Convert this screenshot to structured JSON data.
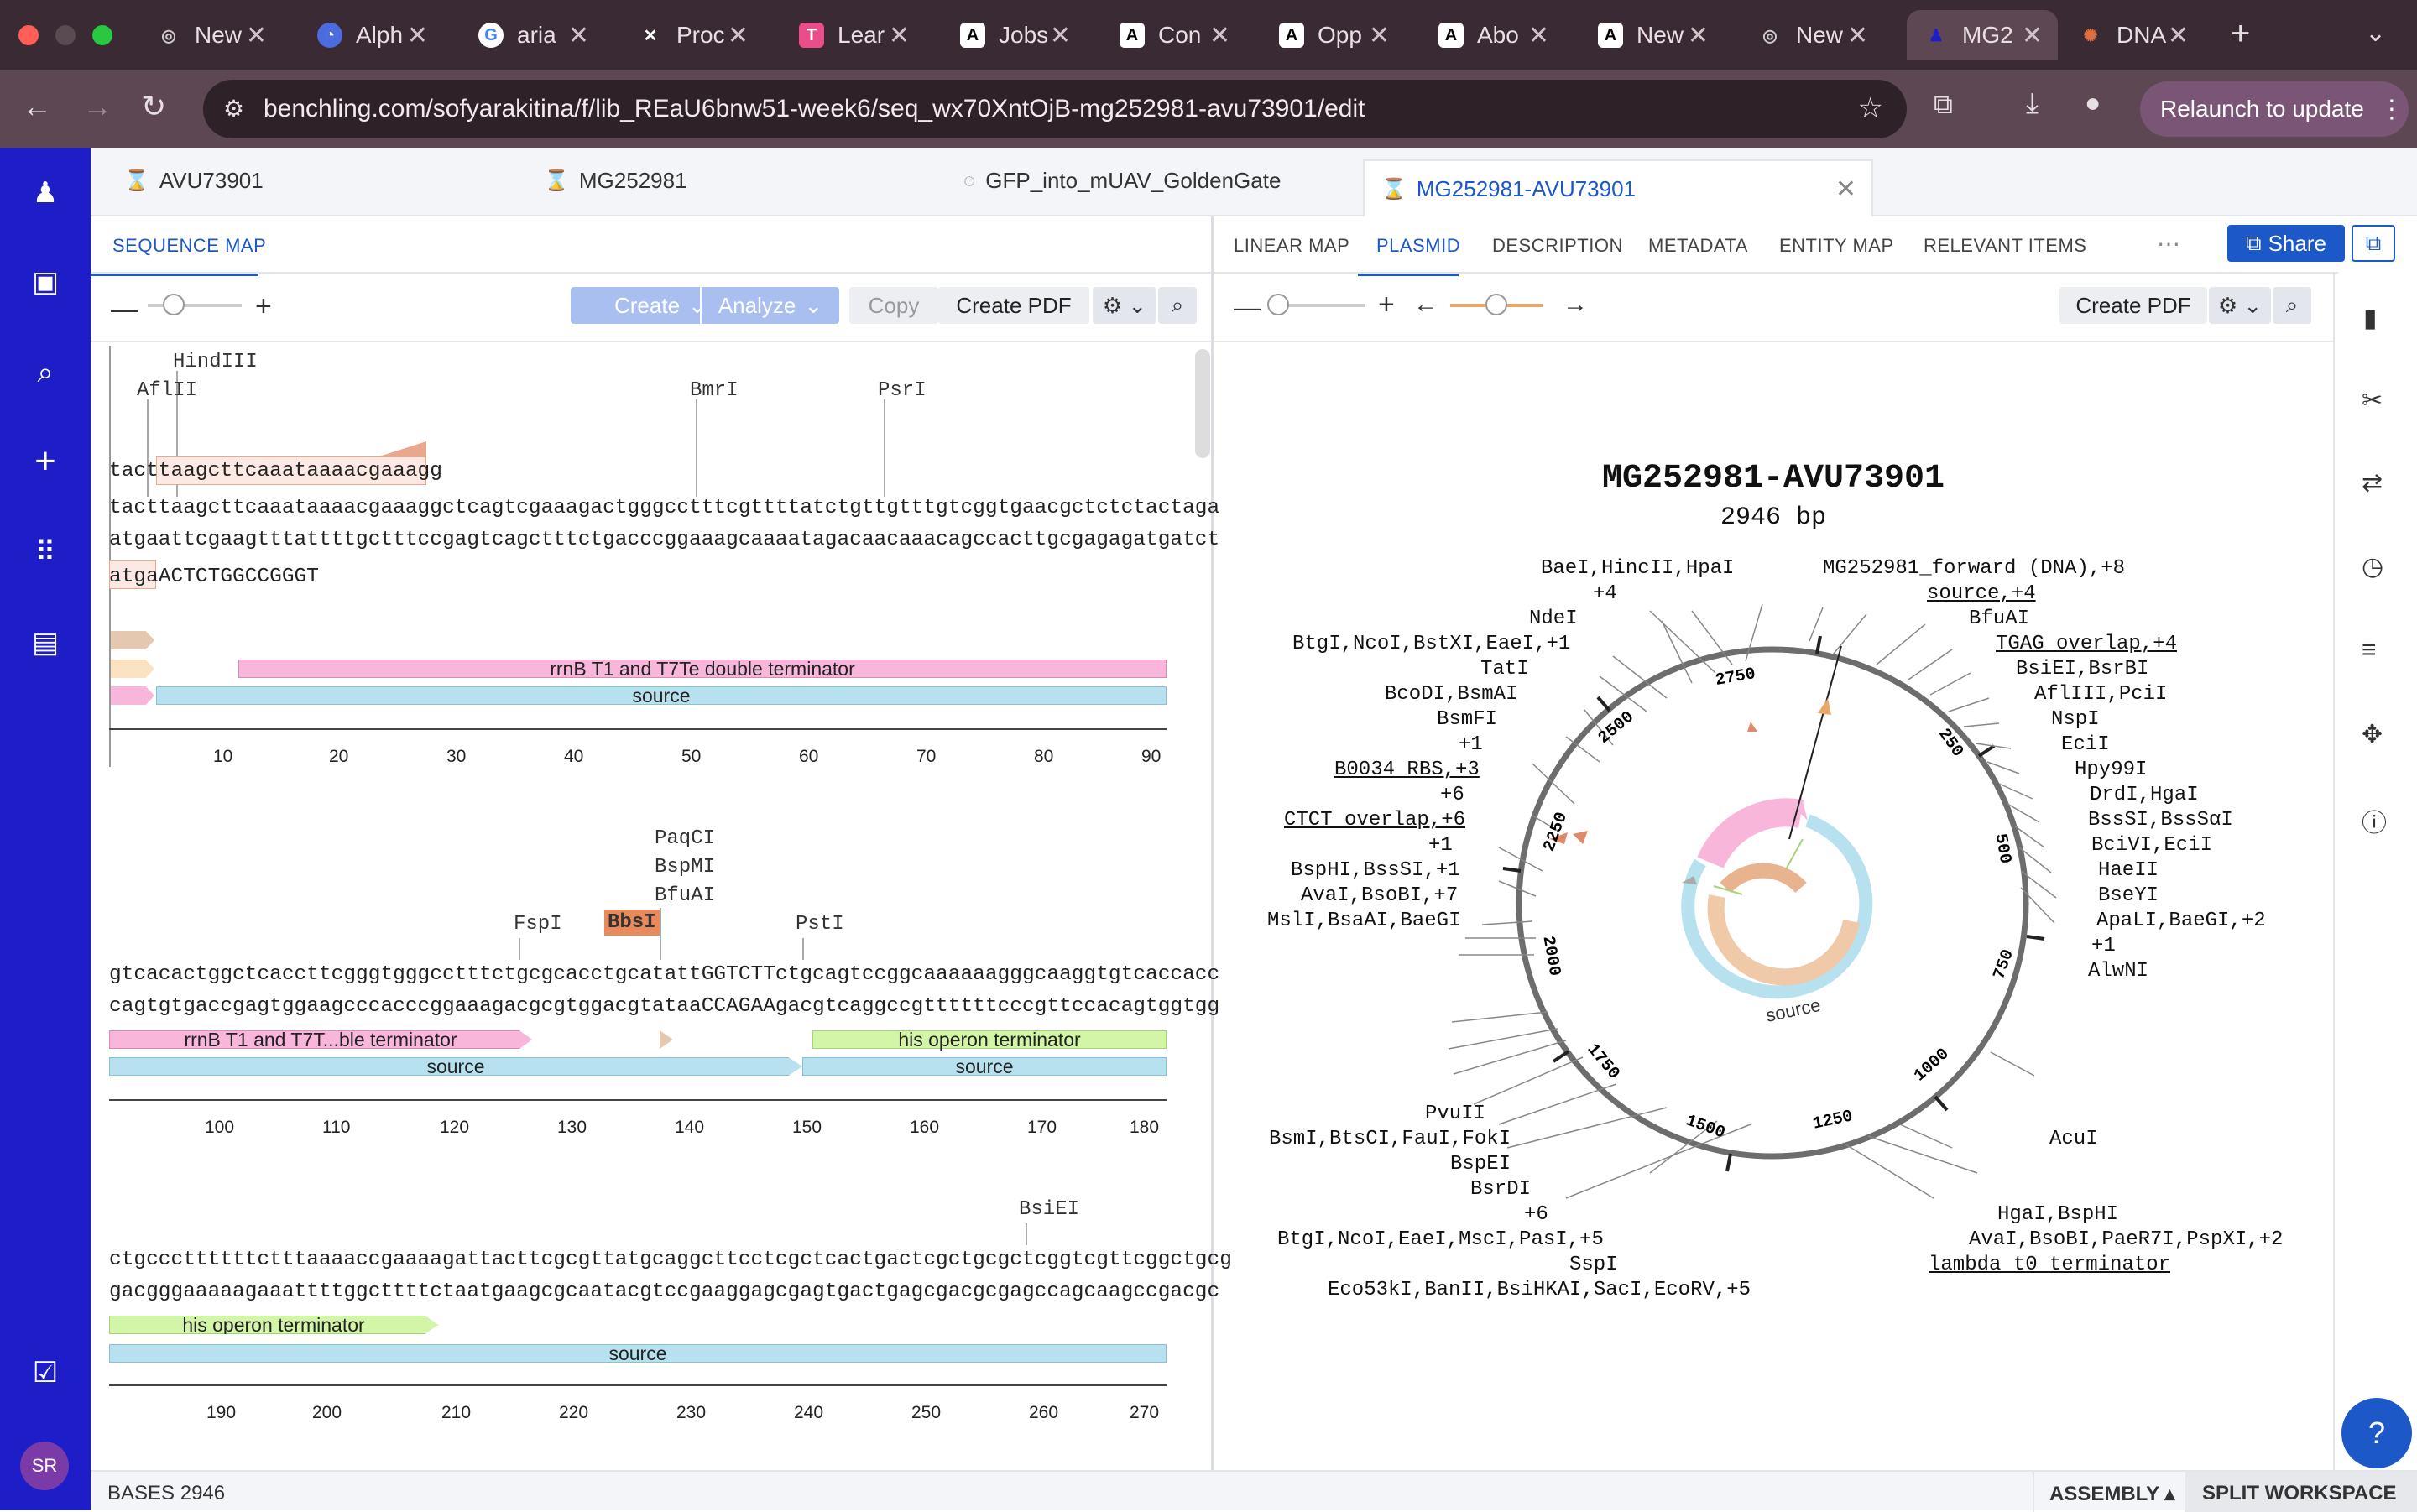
{
  "browser": {
    "tabs": [
      "New",
      "Alph",
      "aria",
      "Proc",
      "Lear",
      "Jobs",
      "Con",
      "Opp",
      "Abo",
      "New",
      "New",
      "MG2",
      "DNA"
    ],
    "url": "benchling.com/sofyarakitina/f/lib_REaU6bnw51-week6/seq_wx70XntOjB-mg252981-avu73901/edit",
    "relaunch": "Relaunch to update"
  },
  "doc_tabs": [
    "AVU73901",
    "MG252981",
    "GFP_into_mUAV_GoldenGate",
    "MG252981-AVU73901"
  ],
  "left": {
    "title": "SEQUENCE MAP",
    "create": "Create",
    "analyze": "Analyze",
    "copy": "Copy",
    "pdf": "Create PDF"
  },
  "right": {
    "tabs": [
      "LINEAR MAP",
      "PLASMID",
      "DESCRIPTION",
      "METADATA",
      "ENTITY MAP",
      "RELEVANT ITEMS"
    ],
    "share": "Share",
    "pdf": "Create PDF"
  },
  "seq": {
    "b1": {
      "enz": [
        "HindIII",
        "AflII",
        "BmrI",
        "PsrI"
      ],
      "primer": "tacttaagcttcaaataaaacgaaagg",
      "top": "tacttaagcttcaaataaaacgaaaggctcagtcgaaagactgggcctttcgttttatctgttgtttgtcggtgaacgctctctactaga",
      "bot": "atgaattcgaagtttattttgctttccgagtcagctttctgacccggaaagcaaaatagacaacaaacagccacttgcgagagatgatct",
      "tail_a": "atga",
      "tail_b": "ACTCTGGCCGGGT",
      "feat": [
        "rrnB T1 and T7Te double terminator",
        "source"
      ],
      "ticks": [
        "10",
        "20",
        "30",
        "40",
        "50",
        "60",
        "70",
        "80",
        "90"
      ]
    },
    "b2": {
      "enz": [
        "PaqCI",
        "BspMI",
        "BfuAI",
        "FspI",
        "BbsI",
        "PstI"
      ],
      "top": "gtcacactggctcaccttcgggtgggcctttctgcgcacctgcatattGGTCTTctgcagtccggcaaaaaagggcaaggtgtcaccacc",
      "bot": "cagtgtgaccgagtggaagcccacccggaaagacgcgtggacgtataaCCAGAAgacgtcaggccgttttttcccgttccacagtggtgg",
      "feat": [
        "rrnB T1 and T7T...ble terminator",
        "his operon terminator",
        "source",
        "source"
      ],
      "ticks": [
        "100",
        "110",
        "120",
        "130",
        "140",
        "150",
        "160",
        "170",
        "180"
      ]
    },
    "b3": {
      "enz": [
        "BsiEI"
      ],
      "top": "ctgcccttttttctttaaaaccgaaaagattacttcgcgttatgcaggcttcctcgctcactgactcgctgcgctcggtcgttcggctgcg",
      "bot": "gacgggaaaaagaaattttggcttttctaatgaagcgcaatacgtccgaaggagcgagtgactgagcgacgcgagccagcaagccgacgc",
      "feat": [
        "his operon terminator",
        "source"
      ],
      "ticks": [
        "190",
        "200",
        "210",
        "220",
        "230",
        "240",
        "250",
        "260",
        "270"
      ]
    }
  },
  "plasmid": {
    "name": "MG252981-AVU73901",
    "size": "2946 bp",
    "source_label": "source",
    "ring_ticks": [
      "250",
      "500",
      "750",
      "1000",
      "1250",
      "1500",
      "1750",
      "2000",
      "2250",
      "2500",
      "2750"
    ],
    "labels_left": [
      "BaeI,HincII,HpaI",
      "+4",
      "NdeI",
      "BtgI,NcoI,BstXI,EaeI,+1",
      "TatI",
      "BcoDI,BsmAI",
      "BsmFI",
      "+1",
      "B0034 RBS,+3",
      "+6",
      "CTCT overlap,+6",
      "+1",
      "BspHI,BssSI,+1",
      "AvaI,BsoBI,+7",
      "MslI,BsaAI,BaeGI",
      "PvuII",
      "BsmI,BtsCI,FauI,FokI",
      "BspEI",
      "BsrDI",
      "+6",
      "BtgI,NcoI,EaeI,MscI,PasI,+5",
      "SspI",
      "Eco53kI,BanII,BsiHKAI,SacI,EcoRV,+5"
    ],
    "labels_right": [
      "MG252981_forward (DNA),+8",
      "source,+4",
      "BfuAI",
      "TGAG overlap,+4",
      "BsiEI,BsrBI",
      "AflIII,PciI",
      "NspI",
      "EciI",
      "Hpy99I",
      "DrdI,HgaI",
      "BssSI,BssSαI",
      "BciVI,EciI",
      "HaeII",
      "BseYI",
      "ApaLI,BaeGI,+2",
      "+1",
      "AlwNI",
      "AcuI",
      "HgaI,BspHI",
      "AvaI,BsoBI,PaeR7I,PspXI,+2",
      "lambda t0 terminator"
    ]
  },
  "status": {
    "bases_label": "BASES",
    "bases": "2946",
    "assembly": "ASSEMBLY",
    "split": "SPLIT WORKSPACE"
  },
  "avatar": "SR"
}
